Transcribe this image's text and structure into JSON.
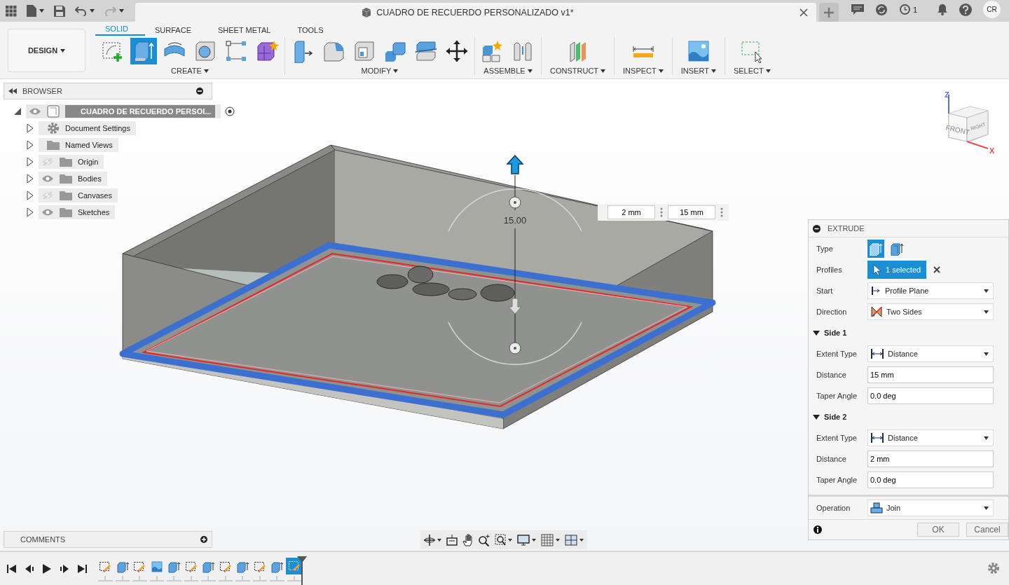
{
  "window": {
    "title": "CUADRO DE RECUERDO PERSONALIZADO v1*"
  },
  "top_bar": {
    "job_count": "1",
    "user_initials": "CR"
  },
  "workspace": {
    "label": "DESIGN"
  },
  "tabs": [
    {
      "label": "SOLID",
      "selected": true
    },
    {
      "label": "SURFACE",
      "selected": false
    },
    {
      "label": "SHEET METAL",
      "selected": false
    },
    {
      "label": "TOOLS",
      "selected": false
    }
  ],
  "tool_groups": [
    {
      "label": "CREATE",
      "tools": [
        {
          "kind": "sketch",
          "selected": false
        },
        {
          "kind": "extrude",
          "selected": true
        },
        {
          "kind": "revolve",
          "selected": false
        },
        {
          "kind": "hole",
          "selected": false
        },
        {
          "kind": "pattern",
          "selected": false
        },
        {
          "kind": "form",
          "selected": false
        }
      ]
    },
    {
      "label": "MODIFY",
      "tools": [
        {
          "kind": "presspull",
          "selected": false
        },
        {
          "kind": "fillet",
          "selected": false
        },
        {
          "kind": "shell",
          "selected": false
        },
        {
          "kind": "combine",
          "selected": false
        },
        {
          "kind": "offset",
          "selected": false
        },
        {
          "kind": "move",
          "selected": false
        }
      ]
    },
    {
      "label": "ASSEMBLE",
      "tools": [
        {
          "kind": "component",
          "selected": false
        },
        {
          "kind": "joint",
          "selected": false
        }
      ]
    },
    {
      "label": "CONSTRUCT",
      "tools": [
        {
          "kind": "plane",
          "selected": false
        }
      ]
    },
    {
      "label": "INSPECT",
      "tools": [
        {
          "kind": "measure",
          "selected": false
        }
      ]
    },
    {
      "label": "INSERT",
      "tools": [
        {
          "kind": "image",
          "selected": false
        }
      ]
    },
    {
      "label": "SELECT",
      "tools": [
        {
          "kind": "select",
          "selected": false
        }
      ]
    }
  ],
  "browser": {
    "title": "BROWSER",
    "tree": [
      {
        "label": "CUADRO DE RECUERDO PERSOI...",
        "kind": "component",
        "expanded": true,
        "visible": true,
        "active": true,
        "children": [
          {
            "label": "Document Settings",
            "kind": "settings",
            "expanded": false
          },
          {
            "label": "Named Views",
            "kind": "folder",
            "expanded": false
          },
          {
            "label": "Origin",
            "kind": "folder",
            "expanded": false,
            "visible": false
          },
          {
            "label": "Bodies",
            "kind": "folder",
            "expanded": false,
            "visible": true
          },
          {
            "label": "Canvases",
            "kind": "folder",
            "expanded": false,
            "visible": false
          },
          {
            "label": "Sketches",
            "kind": "folder",
            "expanded": false,
            "visible": true
          }
        ]
      }
    ]
  },
  "viewport": {
    "dimension_label": "15.00",
    "view_cube": {
      "faces": [
        "FRONT",
        "RIGHT"
      ],
      "axes": [
        "Z",
        "X"
      ]
    }
  },
  "dimension_inputs": [
    {
      "value": "2 mm"
    },
    {
      "value": "15 mm"
    }
  ],
  "extrude_panel": {
    "title": "EXTRUDE",
    "rows": [
      {
        "kind": "type",
        "label": "Type",
        "options": [
          {
            "kind": "solid",
            "selected": true
          },
          {
            "kind": "thin",
            "selected": false
          }
        ]
      },
      {
        "kind": "selection",
        "label": "Profiles",
        "value": "1 selected"
      },
      {
        "kind": "dropdown",
        "label": "Start",
        "value": "Profile Plane"
      },
      {
        "kind": "dropdown",
        "label": "Direction",
        "value": "Two Sides"
      },
      {
        "kind": "section",
        "label": "Side 1",
        "expanded": true
      },
      {
        "kind": "dropdown",
        "label": "Extent Type",
        "value": "Distance"
      },
      {
        "kind": "input",
        "label": "Distance",
        "value": "15 mm"
      },
      {
        "kind": "input",
        "label": "Taper Angle",
        "value": "0.0 deg"
      },
      {
        "kind": "section",
        "label": "Side 2",
        "expanded": true
      },
      {
        "kind": "dropdown",
        "label": "Extent Type",
        "value": "Distance"
      },
      {
        "kind": "input",
        "label": "Distance",
        "value": "2 mm"
      },
      {
        "kind": "input",
        "label": "Taper Angle",
        "value": "0.0 deg"
      }
    ],
    "operation": {
      "label": "Operation",
      "value": "Join"
    },
    "buttons": [
      {
        "label": "OK"
      },
      {
        "label": "Cancel"
      }
    ]
  },
  "comments": {
    "title": "COMMENTS"
  },
  "timeline": {
    "items": [
      {
        "kind": "sketch",
        "selected": false
      },
      {
        "kind": "extrude",
        "selected": false
      },
      {
        "kind": "sketch",
        "selected": false
      },
      {
        "kind": "canvas",
        "selected": false
      },
      {
        "kind": "extrude",
        "selected": false
      },
      {
        "kind": "sketch",
        "selected": false
      },
      {
        "kind": "extrude",
        "selected": false
      },
      {
        "kind": "sketch",
        "selected": false
      },
      {
        "kind": "extrude",
        "selected": false
      },
      {
        "kind": "sketch",
        "selected": false
      },
      {
        "kind": "extrude",
        "selected": false
      },
      {
        "kind": "sketch",
        "selected": true
      }
    ]
  }
}
